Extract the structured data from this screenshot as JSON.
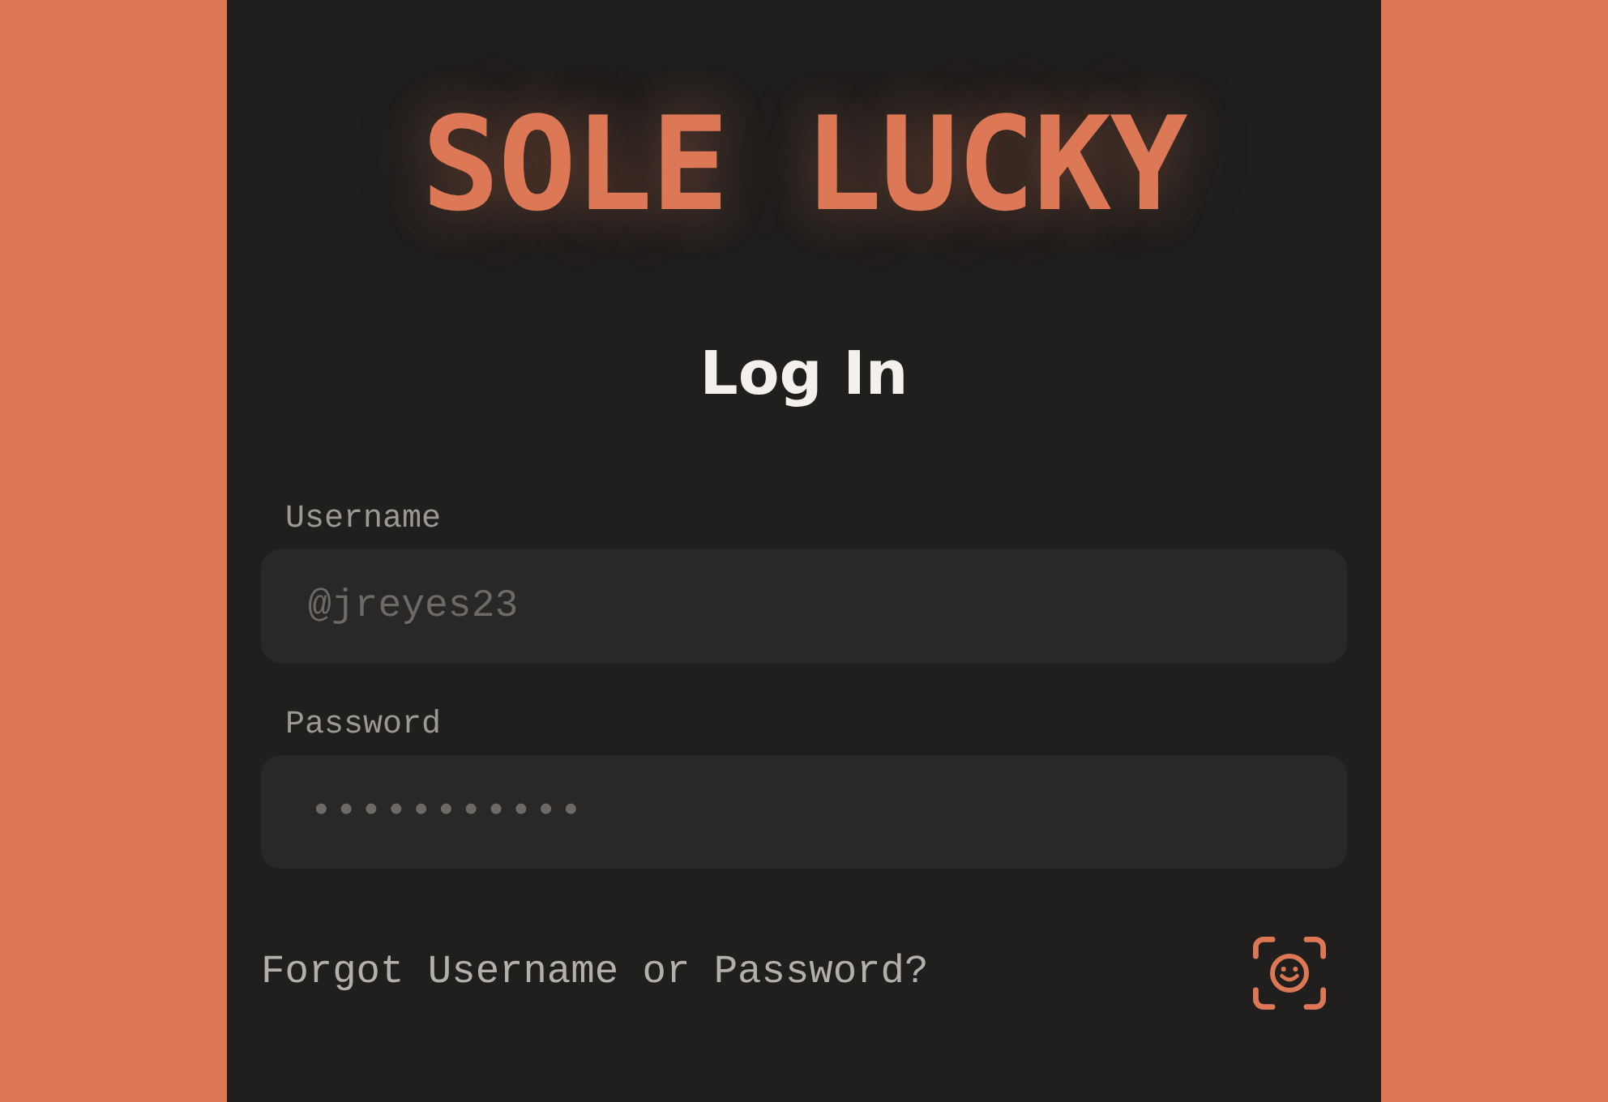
{
  "logo": {
    "text": "SOLE LUCKY"
  },
  "heading": "Log In",
  "fields": [
    {
      "kind": "text",
      "label": "Username",
      "placeholder": "@jreyes23"
    },
    {
      "kind": "password",
      "label": "Password",
      "placeholder": "•••••••••••"
    }
  ],
  "forgot_link": "Forgot Username or Password?"
}
